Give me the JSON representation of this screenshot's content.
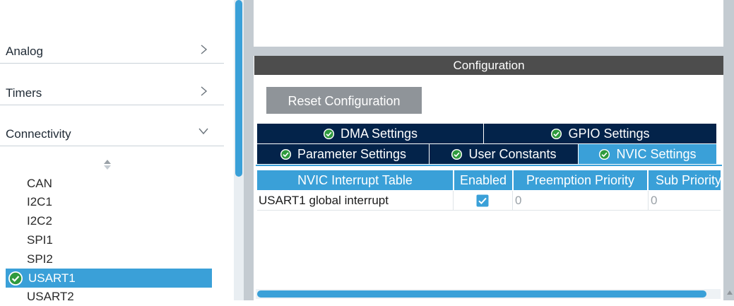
{
  "categories": {
    "analog": "Analog",
    "timers": "Timers",
    "connectivity": "Connectivity"
  },
  "peripherals": [
    "CAN",
    "I2C1",
    "I2C2",
    "SPI1",
    "SPI2",
    "USART1",
    "USART2"
  ],
  "selected_peripheral": "USART1",
  "configuration": {
    "title": "Configuration",
    "reset_label": "Reset Configuration"
  },
  "tabs": {
    "dma": "DMA Settings",
    "gpio": "GPIO Settings",
    "parameter": "Parameter Settings",
    "user_constants": "User Constants",
    "nvic": "NVIC Settings",
    "active": "NVIC Settings"
  },
  "nvic_table": {
    "headers": [
      "NVIC Interrupt Table",
      "Enabled",
      "Preemption Priority",
      "Sub Priority"
    ],
    "rows": [
      {
        "name": "USART1 global interrupt",
        "enabled": true,
        "preemption": "0",
        "sub": "0"
      }
    ]
  },
  "colors": {
    "accent": "#3aa0d8",
    "tab_dark": "#03234a",
    "header_dark": "#4d4d4d",
    "button_gray": "#8f9499"
  },
  "icons": {
    "category_collapsed": "chevron-right-icon",
    "category_expanded": "chevron-down-icon",
    "sort": "sort-icon",
    "status_ok": "check-circle-icon",
    "checkbox": "checkbox-checked-icon"
  }
}
